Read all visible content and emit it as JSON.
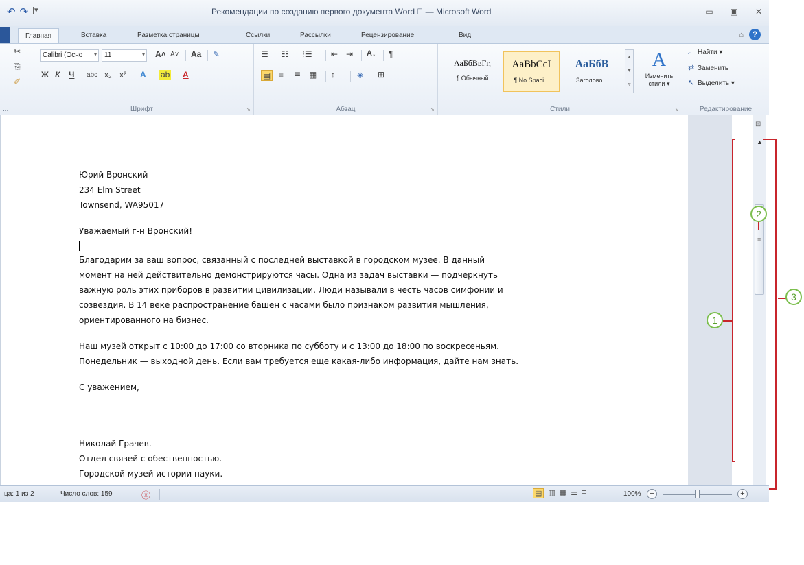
{
  "window": {
    "title": "Рекомендации по созданию первого документа Word \u0000 — Microsoft Word",
    "qat_undo": "↶",
    "qat_redo": "↷",
    "qat_more": "|▾",
    "minimize": "▭",
    "maximize": "▣",
    "close": "✕"
  },
  "tabs": [
    "Главная",
    "Вставка",
    "Разметка страницы",
    "Ссылки",
    "Рассылки",
    "Рецензирование",
    "Вид"
  ],
  "help": {
    "caret": "⌂",
    "icon": "?"
  },
  "ribbon": {
    "font": {
      "name": "Calibri (Осно",
      "size": "11",
      "label": "Шрифт",
      "grow": "A˄",
      "shrink": "A˅",
      "case": "Aa",
      "clear": "✎",
      "bold": "Ж",
      "italic": "К",
      "underline": "Ч",
      "strike": "abc",
      "sub": "x₂",
      "sup": "x²",
      "effects": "A",
      "highlight": "ab",
      "color": "A"
    },
    "paragraph": {
      "label": "Абзац",
      "bullets": "☰",
      "numbering": "☷",
      "multilevel": "⁝☰",
      "decrease": "⇤",
      "increase": "⇥",
      "sort": "A↓",
      "pilcrow": "¶",
      "align_left": "▤",
      "align_center": "≡",
      "align_right": "≣",
      "justify": "▦",
      "spacing": "↕",
      "shading": "◈",
      "borders": "⊞"
    },
    "styles": {
      "label": "Стили",
      "items": [
        {
          "sample": "АаБбВвГг,",
          "name": "¶ Обычный"
        },
        {
          "sample": "AaBbCcI",
          "name": "¶ No Spaci..."
        },
        {
          "sample": "АаБбВ",
          "name": "Заголово..."
        }
      ],
      "change_styles": "Изменить стили ▾",
      "change_icon": "A"
    },
    "editing": {
      "label": "Редактирование",
      "find": "Найти ▾",
      "replace": "Заменить",
      "select": "Выделить ▾"
    },
    "clipboard": {
      "paste_label": "...",
      "cut": "✂",
      "copy": "⎘",
      "format": "✐"
    }
  },
  "document": {
    "address": [
      "Юрий Вронский",
      "234 Elm Street",
      "Townsend, WA95017"
    ],
    "salutation": "Уважаемый г-н Вронский!",
    "paragraph1": [
      "Благодарим за ваш вопрос, связанный с последней выставкой в городском музее. В данный",
      "момент на ней действительно демонстрируются часы. Одна из задач выставки — подчеркнуть",
      "важную роль этих приборов в развитии цивилизации. Люди называли в честь часов симфонии и",
      "созвездия. В 14 веке распространение башен с часами было признаком развития мышления,",
      "ориентированного на бизнес."
    ],
    "paragraph2": [
      "Наш музей открыт с 10:00 до 17:00 со вторника по субботу и с 13:00 до 18:00 по воскресеньям.",
      "Понедельник — выходной день. Если вам требуется еще какая-либо информация, дайте нам знать."
    ],
    "closing": "С уважением,",
    "signature": [
      "Николай Грачев.",
      "Отдел связей с обественностью.",
      "Городской музей истории науки."
    ]
  },
  "callouts": [
    "1",
    "2",
    "3"
  ],
  "statusbar": {
    "page": "ца: 1 из 2",
    "words": "Число слов: 159",
    "proof": "ⓧ",
    "zoom": "100%",
    "zoom_out": "−",
    "zoom_in": "+"
  },
  "scrollbar": {
    "up": "▲",
    "down": "▼",
    "grip": "≡",
    "browse": [
      "↑",
      "○",
      "↓"
    ],
    "ruler": "⊡"
  }
}
